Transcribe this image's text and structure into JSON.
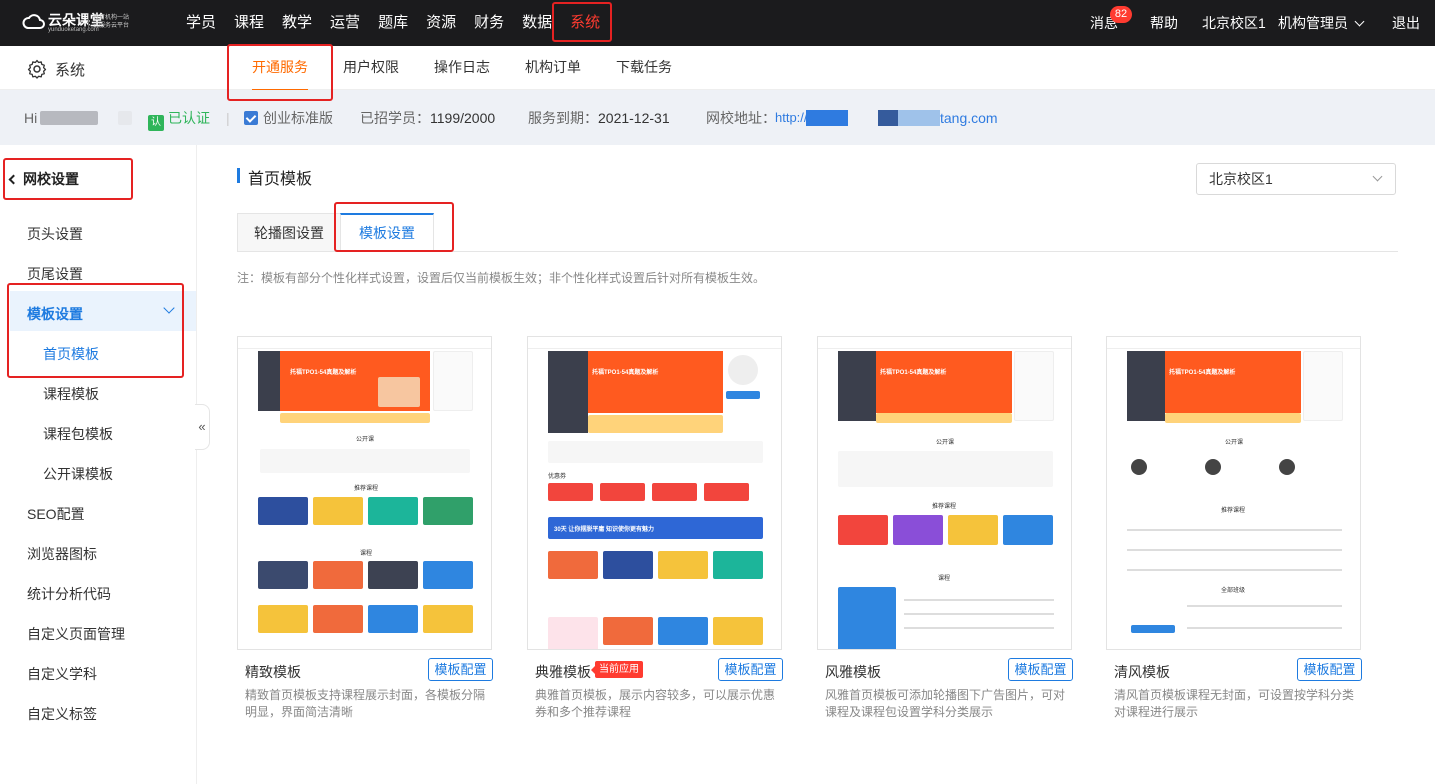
{
  "topbar": {
    "logo_name": "云朵课堂",
    "logo_url": "yunduoketang.com",
    "logo_tag_1": "教育机构一站",
    "logo_tag_2": "式服务云平台",
    "nav": [
      "学员",
      "课程",
      "教学",
      "运营",
      "题库",
      "资源",
      "财务",
      "数据",
      "系统"
    ],
    "active_nav": "系统",
    "messages_label": "消息",
    "messages_count": "82",
    "help_label": "帮助",
    "campus_label": "北京校区1",
    "admin_label": "机构管理员",
    "logout_label": "退出"
  },
  "secbar": {
    "section_label": "系统",
    "tabs": [
      "开通服务",
      "用户权限",
      "操作日志",
      "机构订单",
      "下载任务"
    ],
    "active_tab": "开通服务"
  },
  "infobar": {
    "greeting": "Hi",
    "verified_label": "已认证",
    "verified_icon": "认",
    "edition_label": "创业标准版",
    "students_label": "已招学员：",
    "students_value": "1199/2000",
    "expiry_label": "服务到期：",
    "expiry_value": "2021-12-31",
    "school_url_label": "网校地址：",
    "school_url_prefix": "http://yuduy",
    "school_url_suffix": "tang.com"
  },
  "sidebar": {
    "back_label": "网校设置",
    "items": [
      "页头设置",
      "页尾设置",
      "模板设置",
      "SEO配置",
      "浏览器图标",
      "统计分析代码",
      "自定义页面管理",
      "自定义学科",
      "自定义标签"
    ],
    "sub_items": [
      "首页模板",
      "课程模板",
      "课程包模板",
      "公开课模板"
    ],
    "active_item": "模板设置",
    "active_sub": "首页模板",
    "collapse_glyph": "«"
  },
  "main": {
    "title": "首页模板",
    "campus_select_value": "北京校区1",
    "tabs": [
      "轮播图设置",
      "模板设置"
    ],
    "active_tab": "模板设置",
    "note": "注：模板有部分个性化样式设置，设置后仅当前模板生效；非个性化样式设置后针对所有模板生效。",
    "config_label": "模板配置",
    "current_badge": "当前应用",
    "cards": [
      {
        "name": "精致模板",
        "desc": "精致首页模板支持课程展示封面，各模板分隔明显，界面简洁清晰",
        "current": false
      },
      {
        "name": "典雅模板",
        "desc": "典雅首页模板，展示内容较多，可以展示优惠券和多个推荐课程",
        "current": true
      },
      {
        "name": "风雅模板",
        "desc": "风雅首页模板可添加轮播图下广告图片，可对课程及课程包设置学科分类展示",
        "current": false
      },
      {
        "name": "清风模板",
        "desc": "清风首页模板课程无封面，可设置按学科分类对课程进行展示",
        "current": false
      }
    ],
    "preview_texts": {
      "banner_title": "托福TPO1-54真题及解析",
      "public_course": "公开课",
      "recommend": "推荐课程",
      "course": "课程",
      "slogan": "30天 让你摆脱平庸 知识使你更有魅力",
      "all_classes": "全部班级",
      "coupon": "优惠券"
    }
  },
  "colors": {
    "accent": "#1e7be0",
    "active_orange": "#ff6a00",
    "alert_red": "#ff3b30",
    "verified_green": "#2fb55a"
  }
}
